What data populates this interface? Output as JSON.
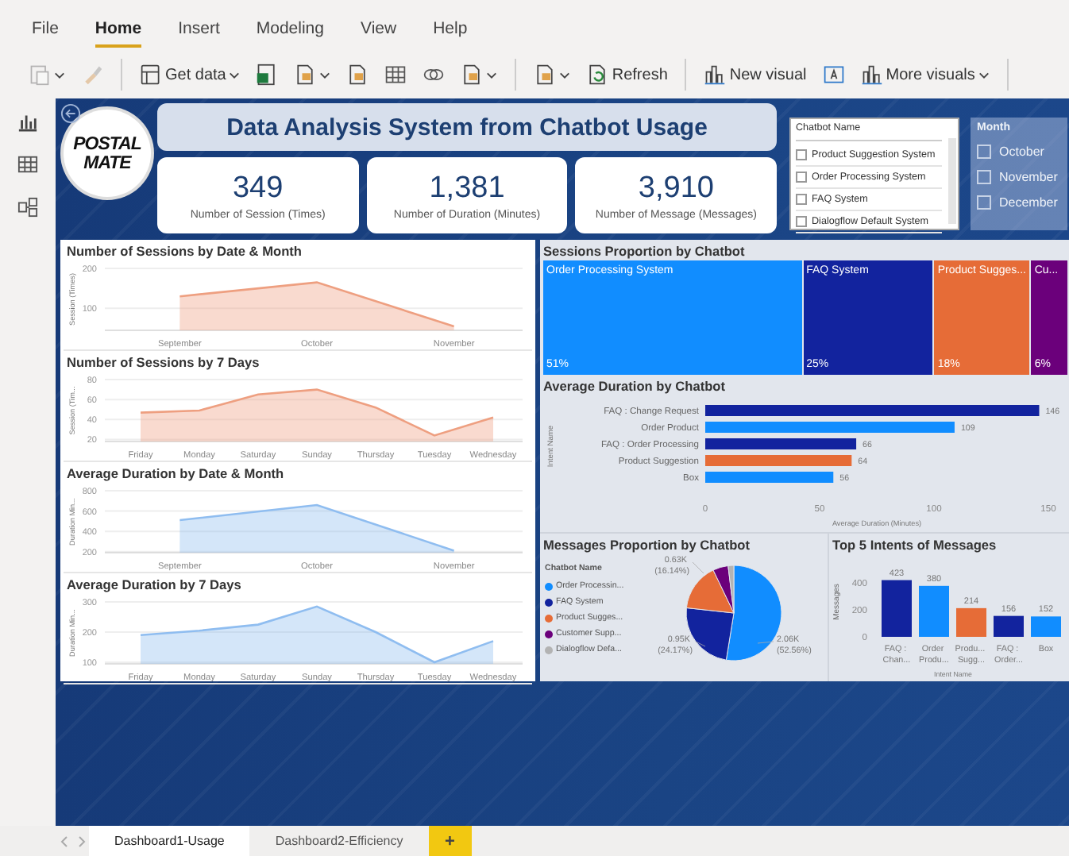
{
  "menu": [
    {
      "label": "File",
      "selected": false
    },
    {
      "label": "Home",
      "selected": true
    },
    {
      "label": "Insert",
      "selected": false
    },
    {
      "label": "Modeling",
      "selected": false
    },
    {
      "label": "View",
      "selected": false
    },
    {
      "label": "Help",
      "selected": false
    }
  ],
  "toolbar": [
    {
      "kind": "icon",
      "dropdown": true,
      "disabled": true
    },
    {
      "kind": "icon",
      "dropdown": false,
      "disabled": true
    },
    {
      "kind": "separator"
    },
    {
      "kind": "button",
      "label": "Get data",
      "dropdown": true
    },
    {
      "kind": "icon",
      "dropdown": false,
      "disabled": false
    },
    {
      "kind": "icon",
      "dropdown": true,
      "disabled": false
    },
    {
      "kind": "icon",
      "dropdown": false,
      "disabled": false
    },
    {
      "kind": "icon",
      "dropdown": false,
      "disabled": false
    },
    {
      "kind": "icon",
      "dropdown": false,
      "disabled": false
    },
    {
      "kind": "icon",
      "dropdown": true,
      "disabled": false
    },
    {
      "kind": "separator"
    },
    {
      "kind": "icon",
      "dropdown": true,
      "disabled": false
    },
    {
      "kind": "button",
      "label": "Refresh",
      "dropdown": false
    },
    {
      "kind": "separator"
    },
    {
      "kind": "button",
      "label": "New visual",
      "dropdown": false
    },
    {
      "kind": "icon",
      "dropdown": false,
      "disabled": false
    },
    {
      "kind": "button",
      "label": "More visuals",
      "dropdown": true
    },
    {
      "kind": "separator"
    }
  ],
  "report": {
    "logo": [
      "POSTAL",
      "MATE"
    ],
    "title": "Data Analysis System from Chatbot Usage",
    "kpis": [
      {
        "value": "349",
        "label": "Number of Session (Times)"
      },
      {
        "value": "1,381",
        "label": "Number of Duration (Minutes)"
      },
      {
        "value": "3,910",
        "label": "Number of Message (Messages)"
      }
    ],
    "slicers": [
      {
        "title": "Chatbot Name",
        "items": [
          {
            "label": "Product Suggestion System",
            "checked": false
          },
          {
            "label": "Order Processing System",
            "checked": false
          },
          {
            "label": "FAQ System",
            "checked": false
          },
          {
            "label": "Dialogflow Default System",
            "checked": false
          }
        ]
      },
      {
        "title": "Month",
        "items": [
          {
            "label": "October",
            "checked": false
          },
          {
            "label": "November",
            "checked": false
          },
          {
            "label": "December",
            "checked": false
          }
        ]
      }
    ],
    "trend_charts": [
      {
        "chart_data": {
          "type": "area",
          "title": "Number of Sessions by Date & Month",
          "ylabel": "Session (Times)",
          "categories": [
            "September",
            "October",
            "November"
          ],
          "series": [
            {
              "color": "#ee9f80",
              "values": [
                130,
                165,
                55
              ]
            }
          ],
          "ylim": [
            45,
            200
          ],
          "yticks": [
            100,
            200
          ]
        }
      },
      {
        "chart_data": {
          "type": "area",
          "title": "Number of Sessions by 7 Days",
          "ylabel": "Session (Tim...",
          "categories": [
            "Friday",
            "Monday",
            "Saturday",
            "Sunday",
            "Thursday",
            "Tuesday",
            "Wednesday"
          ],
          "series": [
            {
              "color": "#ee9f80",
              "values": [
                47,
                49,
                65,
                70,
                52,
                24,
                42
              ]
            }
          ],
          "ylim": [
            18,
            80
          ],
          "yticks": [
            20,
            40,
            60,
            80
          ]
        }
      },
      {
        "chart_data": {
          "type": "area",
          "title": "Average Duration by Date & Month",
          "ylabel": "Duration Min...",
          "categories": [
            "September",
            "October",
            "November"
          ],
          "series": [
            {
              "color": "#8fbdf0",
              "values": [
                510,
                660,
                210
              ]
            }
          ],
          "ylim": [
            190,
            800
          ],
          "yticks": [
            200,
            400,
            600,
            800
          ]
        }
      },
      {
        "chart_data": {
          "type": "area",
          "title": "Average Duration by 7 Days",
          "ylabel": "Duration Min...",
          "categories": [
            "Friday",
            "Monday",
            "Saturday",
            "Sunday",
            "Thursday",
            "Tuesday",
            "Wednesday"
          ],
          "series": [
            {
              "color": "#8fbdf0",
              "values": [
                190,
                205,
                225,
                285,
                200,
                100,
                170
              ]
            }
          ],
          "ylim": [
            95,
            300
          ],
          "yticks": [
            100,
            200,
            300
          ]
        }
      }
    ],
    "treemap": {
      "title": "Sessions Proportion by Chatbot",
      "tiles": [
        {
          "label": "Order Processing System",
          "share": "51%",
          "color": "#118dff"
        },
        {
          "label": "FAQ System",
          "share": "25%",
          "color": "#12239e"
        },
        {
          "label": "Product Sugges...",
          "share": "18%",
          "color": "#e66c37"
        },
        {
          "label": "Cu...",
          "share": "6%",
          "color": "#6b007b"
        }
      ]
    },
    "duration_by_chatbot": {
      "chart_data": {
        "type": "bar",
        "orientation": "horizontal",
        "title": "Average Duration by Chatbot",
        "xlabel": "Average Duration (Minutes)",
        "ylabel": "Intent Name",
        "categories": [
          "FAQ : Change Request",
          "Order Product",
          "FAQ : Order Processing",
          "Product Suggestion",
          "Box"
        ],
        "series": [
          {
            "color": "#12239e",
            "values": [
              146,
              null,
              66,
              null,
              null
            ]
          },
          {
            "color": "#118dff",
            "values": [
              null,
              109,
              null,
              null,
              56
            ]
          },
          {
            "color": "#e66c37",
            "values": [
              null,
              null,
              null,
              64,
              null
            ]
          }
        ],
        "stacked": true,
        "xlim": [
          0,
          150
        ],
        "xticks": [
          0,
          50,
          100,
          150
        ],
        "data_labels": true
      }
    },
    "messages_proportion": {
      "legend": {
        "title": "Chatbot Name",
        "items": [
          {
            "label": "Order Processin...",
            "color": "#118dff"
          },
          {
            "label": "FAQ System",
            "color": "#12239e"
          },
          {
            "label": "Product Sugges...",
            "color": "#e66c37"
          },
          {
            "label": "Customer Supp...",
            "color": "#6b007b"
          },
          {
            "label": "Dialogflow Defa...",
            "color": "#b3b3b3"
          }
        ]
      },
      "chart_data": {
        "type": "pie",
        "title": "Messages Proportion by Chatbot",
        "values": [
          52.56,
          24.17,
          16.14,
          5.2,
          1.93
        ],
        "value_labels": [
          "2.06K (52.56%)",
          "0.95K (24.17%)",
          "0.63K (16.14%)",
          null,
          null
        ]
      }
    },
    "top_intents": {
      "chart_data": {
        "type": "bar",
        "title": "Top 5 Intents of Messages",
        "xlabel": "Intent Name",
        "ylabel": "Messages",
        "categories": [
          "FAQ : Chan...",
          "Order Produ...",
          "Produ... Sugg...",
          "FAQ : Order...",
          "Box"
        ],
        "series": [
          {
            "color": "#12239e",
            "values": [
              423,
              null,
              null,
              156,
              null
            ]
          },
          {
            "color": "#118dff",
            "values": [
              null,
              380,
              null,
              null,
              152
            ]
          },
          {
            "color": "#e66c37",
            "values": [
              null,
              null,
              214,
              null,
              null
            ]
          }
        ],
        "stacked": true,
        "ylim": [
          0,
          450
        ],
        "yticks": [
          0,
          200,
          400
        ],
        "data_labels": true
      }
    }
  },
  "page_tabs": [
    {
      "label": "Dashboard1-Usage",
      "selected": true
    },
    {
      "label": "Dashboard2-Efficiency",
      "selected": false
    }
  ],
  "add_page": "+"
}
